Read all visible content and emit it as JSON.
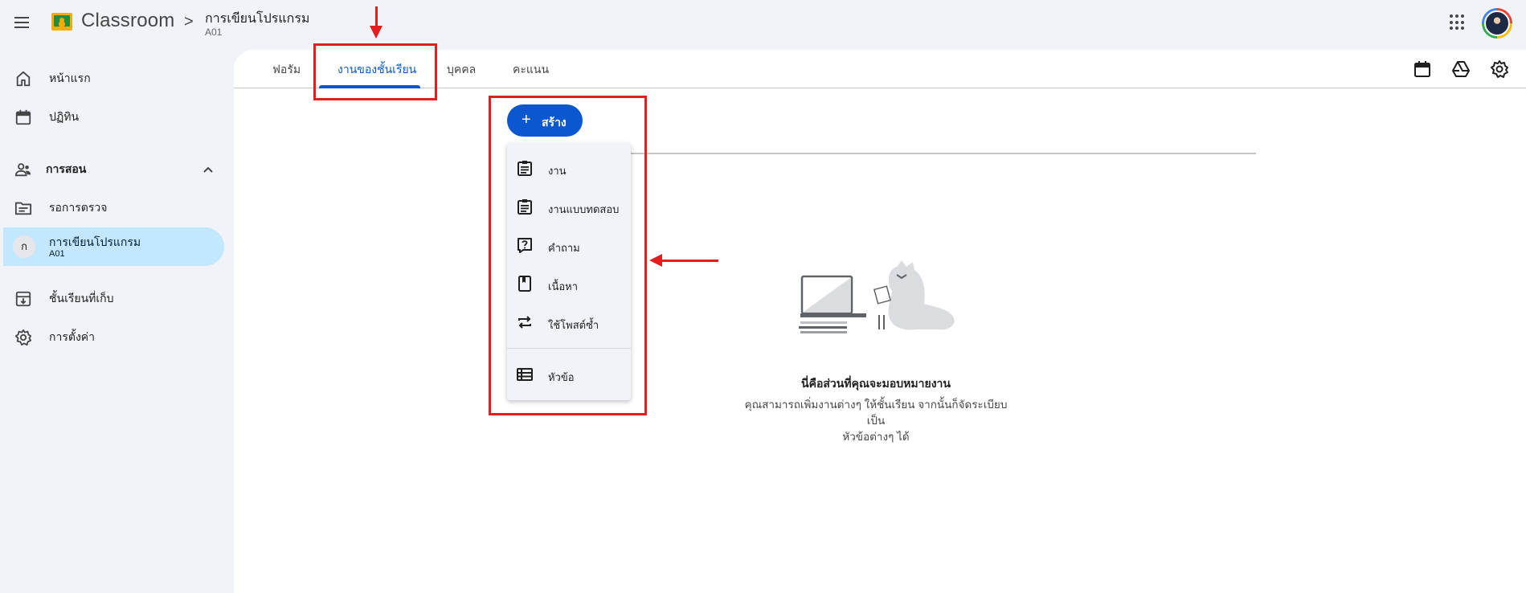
{
  "header": {
    "app_title": "Classroom",
    "breadcrumb_separator": ">",
    "course_title": "การเขียนโปรแกรม",
    "course_section": "A01"
  },
  "sidebar": {
    "home": "หน้าแรก",
    "calendar": "ปฏิทิน",
    "teaching_section": "การสอน",
    "to_review": "รอการตรวจ",
    "active_course": {
      "initial": "ก",
      "title": "การเขียนโปรแกรม",
      "section": "A01"
    },
    "archived": "ชั้นเรียนที่เก็บ",
    "settings": "การตั้งค่า"
  },
  "tabs": {
    "stream": "ฟอรัม",
    "classwork": "งานของชั้นเรียน",
    "people": "บุคคล",
    "grades": "คะแนน",
    "active": "classwork"
  },
  "create_button": {
    "plus": "+",
    "label": "สร้าง"
  },
  "create_menu": {
    "items": [
      {
        "label": "งาน",
        "icon": "assignment-icon"
      },
      {
        "label": "งานแบบทดสอบ",
        "icon": "quiz-assignment-icon"
      },
      {
        "label": "คำถาม",
        "icon": "question-icon"
      },
      {
        "label": "เนื้อหา",
        "icon": "material-icon"
      },
      {
        "label": "ใช้โพสต์ซ้ำ",
        "icon": "reuse-post-icon"
      },
      {
        "label": "หัวข้อ",
        "icon": "topic-icon"
      }
    ]
  },
  "empty_state": {
    "title": "นี่คือส่วนที่คุณจะมอบหมายงาน",
    "description_line1": "คุณสามารถเพิ่มงานต่างๆ ให้ชั้นเรียน จากนั้นก็จัดระเบียบเป็น",
    "description_line2": "หัวข้อต่างๆ ได้"
  },
  "colors": {
    "accent": "#0b57d0",
    "active_nav": "#c2e7ff",
    "annotation_red": "#e41e1e",
    "background": "#f0f4f9"
  }
}
